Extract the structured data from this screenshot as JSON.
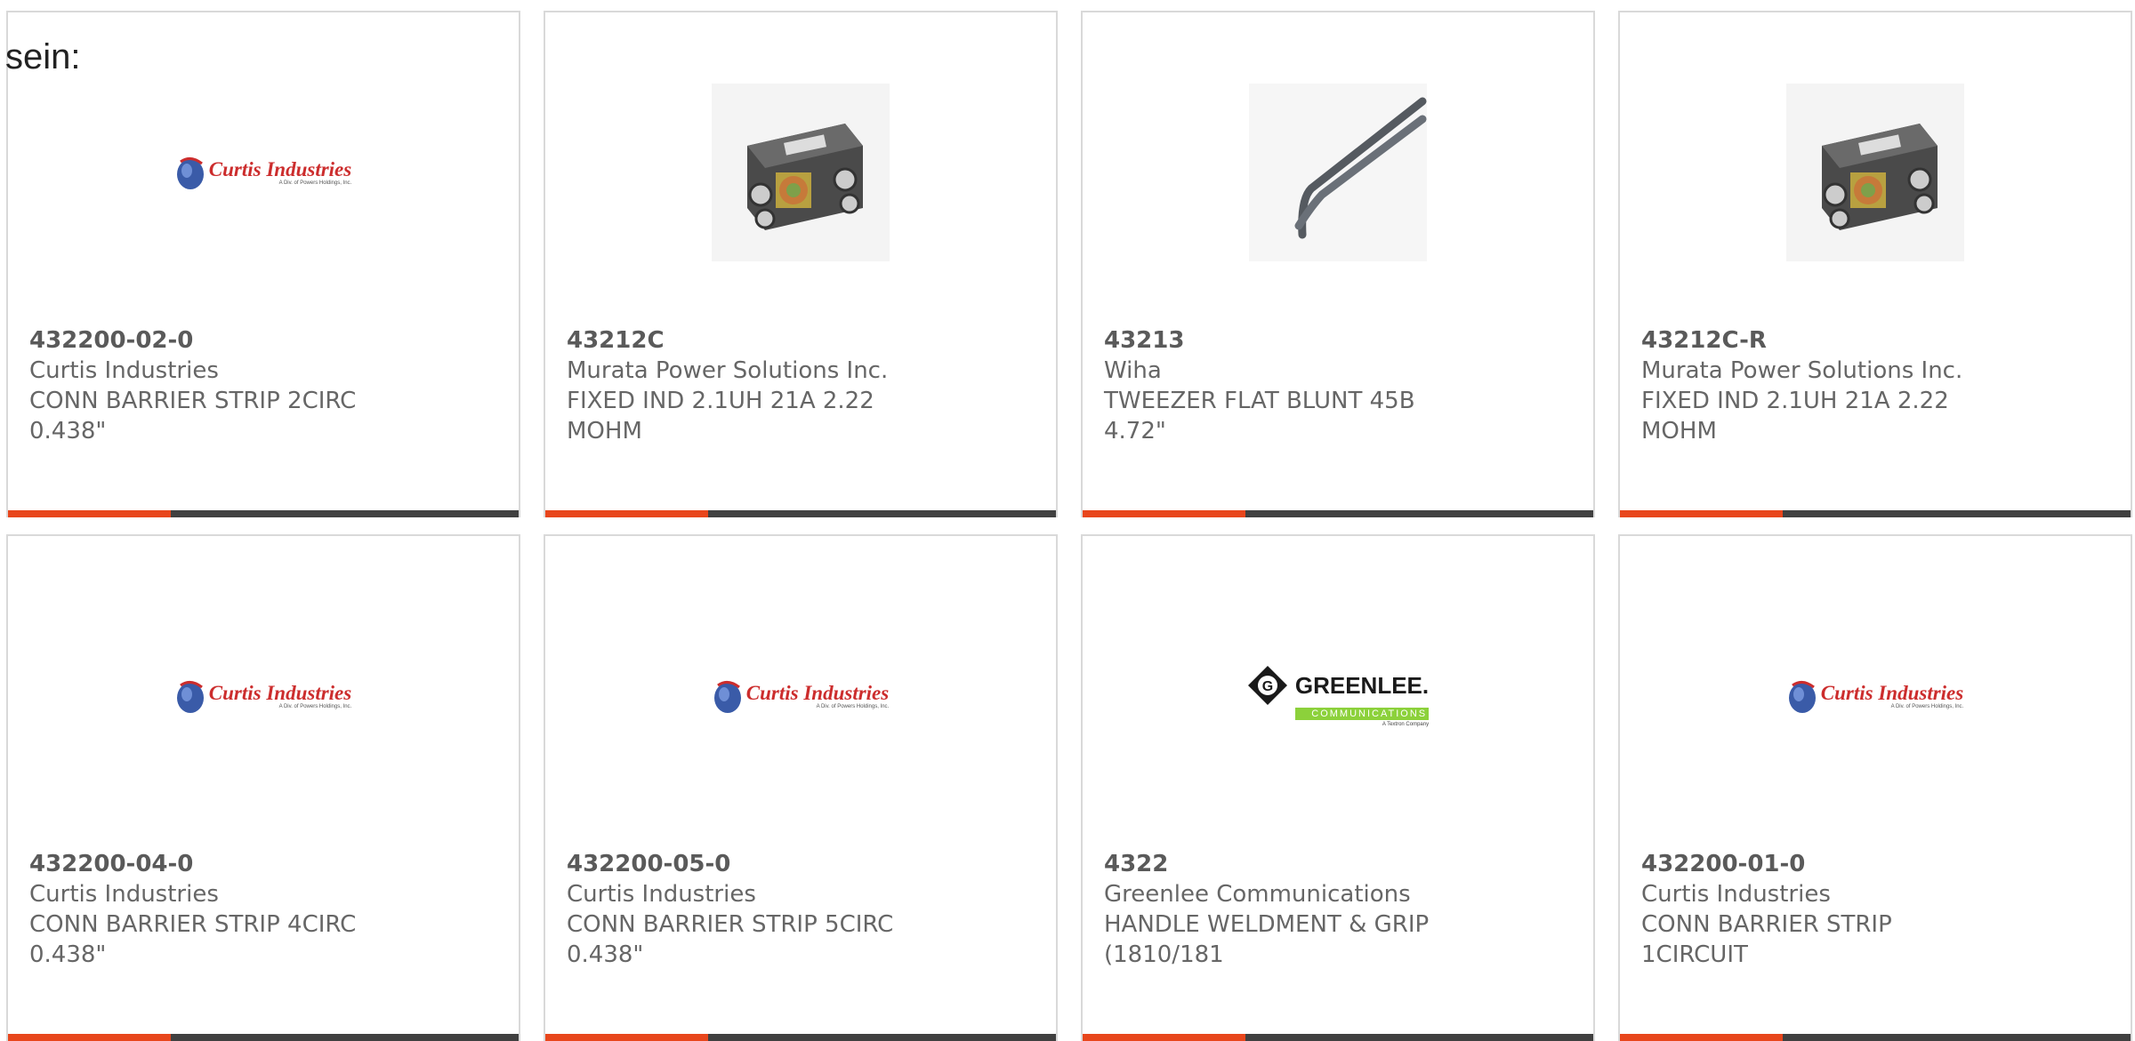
{
  "overlay_text": "sein:",
  "colors": {
    "accent": "#e8461c",
    "bar": "#404040",
    "text": "#666666",
    "border": "#d9d9d9"
  },
  "products": [
    {
      "part_number": "432200-02-0",
      "manufacturer": "Curtis Industries",
      "description": "CONN BARRIER STRIP 2CIRC 0.438\"",
      "image": "curtis-industries-logo",
      "logo": {
        "name": "Curtis Industries",
        "sub": "A Div. of Powers Holdings, Inc."
      }
    },
    {
      "part_number": "43212C",
      "manufacturer": "Murata Power Solutions Inc.",
      "description": "FIXED IND 2.1UH 21A 2.22 MOHM",
      "image": "inductor-photo"
    },
    {
      "part_number": "43213",
      "manufacturer": "Wiha",
      "description": "TWEEZER FLAT BLUNT 45B 4.72\"",
      "image": "tweezer-photo"
    },
    {
      "part_number": "43212C-R",
      "manufacturer": "Murata Power Solutions Inc.",
      "description": "FIXED IND 2.1UH 21A 2.22 MOHM",
      "image": "inductor-photo"
    },
    {
      "part_number": "432200-04-0",
      "manufacturer": "Curtis Industries",
      "description": "CONN BARRIER STRIP 4CIRC 0.438\"",
      "image": "curtis-industries-logo",
      "logo": {
        "name": "Curtis Industries",
        "sub": "A Div. of Powers Holdings, Inc."
      }
    },
    {
      "part_number": "432200-05-0",
      "manufacturer": "Curtis Industries",
      "description": "CONN BARRIER STRIP 5CIRC 0.438\"",
      "image": "curtis-industries-logo",
      "logo": {
        "name": "Curtis Industries",
        "sub": "A Div. of Powers Holdings, Inc."
      }
    },
    {
      "part_number": "4322",
      "manufacturer": "Greenlee Communications",
      "description": "HANDLE WELDMENT & GRIP (1810/181",
      "image": "greenlee-logo",
      "logo": {
        "name": "GREENLEE.",
        "sub": "COMMUNICATIONS",
        "tag": "A Textron Company"
      }
    },
    {
      "part_number": "432200-01-0",
      "manufacturer": "Curtis Industries",
      "description": "CONN BARRIER STRIP 1CIRCUIT",
      "image": "curtis-industries-logo",
      "logo": {
        "name": "Curtis Industries",
        "sub": "A Div. of Powers Holdings, Inc."
      }
    }
  ]
}
